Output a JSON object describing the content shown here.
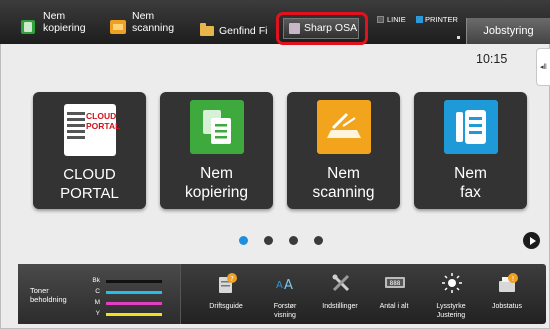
{
  "topbar": {
    "copy": {
      "line1": "Nem",
      "line2": "kopiering"
    },
    "scan": {
      "line1": "Nem",
      "line2": "scanning"
    },
    "find": "Genfind Fi",
    "osa": "Sharp OSA",
    "status_line": "LINIE",
    "status_printer": "PRINTER",
    "jobstatus": "Jobstyring"
  },
  "clock": "10:15",
  "side_tab_glyph": "◂ll",
  "tiles": [
    {
      "label": "CLOUD PORTAL",
      "icon": "cloud-portal-icon",
      "icon_text": [
        "CLOUD",
        "PORTAL"
      ]
    },
    {
      "line1": "Nem",
      "line2": "kopiering",
      "icon": "copy-icon"
    },
    {
      "line1": "Nem",
      "line2": "scanning",
      "icon": "scan-icon"
    },
    {
      "line1": "Nem",
      "line2": "fax",
      "icon": "fax-icon"
    }
  ],
  "pagination": {
    "pages": 4,
    "active": 1
  },
  "toner": {
    "label_line1": "Toner",
    "label_line2": "beholdning",
    "rows": [
      {
        "code": "Bk",
        "color": "#111111"
      },
      {
        "code": "C",
        "color": "#20c0e8"
      },
      {
        "code": "M",
        "color": "#e040c0"
      },
      {
        "code": "Y",
        "color": "#f0e020"
      }
    ]
  },
  "bottom_items": [
    {
      "line1": "Driftsguide",
      "line2": "",
      "icon": "guide-icon"
    },
    {
      "line1": "Forstør",
      "line2": "visning",
      "icon": "magnify-icon"
    },
    {
      "line1": "Indstillinger",
      "line2": "",
      "icon": "settings-icon"
    },
    {
      "line1": "Antal i alt",
      "line2": "",
      "icon": "counter-icon"
    },
    {
      "line1": "Lysstyrke",
      "line2": "Justering",
      "icon": "brightness-icon"
    },
    {
      "line1": "Jobstatus",
      "line2": "",
      "icon": "jobstatus-icon"
    }
  ],
  "colors": {
    "highlight": "#e0121e",
    "active_dot": "#1e8fe0",
    "copy": "#3eaa3e",
    "scan": "#f2a51c",
    "fax": "#1e9ad8"
  }
}
